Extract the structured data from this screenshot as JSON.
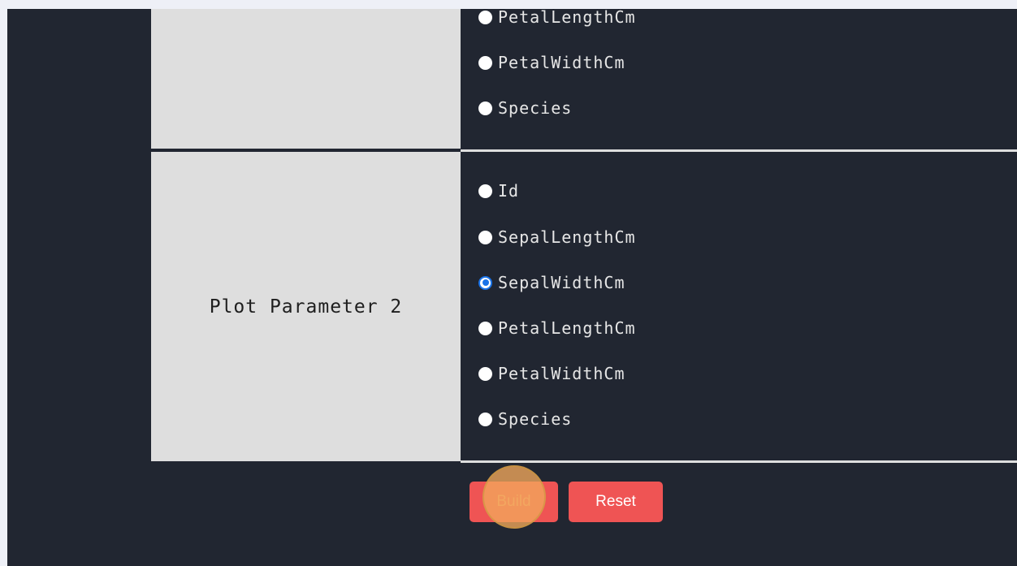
{
  "param1": {
    "options": [
      {
        "label": "PetalLengthCm",
        "checked": false
      },
      {
        "label": "PetalWidthCm",
        "checked": false
      },
      {
        "label": "Species",
        "checked": false
      }
    ]
  },
  "param2": {
    "label": "Plot Parameter 2",
    "options": [
      {
        "label": "Id",
        "checked": false
      },
      {
        "label": "SepalLengthCm",
        "checked": false
      },
      {
        "label": "SepalWidthCm",
        "checked": true
      },
      {
        "label": "PetalLengthCm",
        "checked": false
      },
      {
        "label": "PetalWidthCm",
        "checked": false
      },
      {
        "label": "Species",
        "checked": false
      }
    ]
  },
  "buttons": {
    "build_label": "Build",
    "reset_label": "Reset"
  },
  "colors": {
    "page_bg": "#212631",
    "label_cell_bg": "#dedede",
    "button_bg": "#ef5454",
    "radio_selected": "#1a73e8"
  }
}
